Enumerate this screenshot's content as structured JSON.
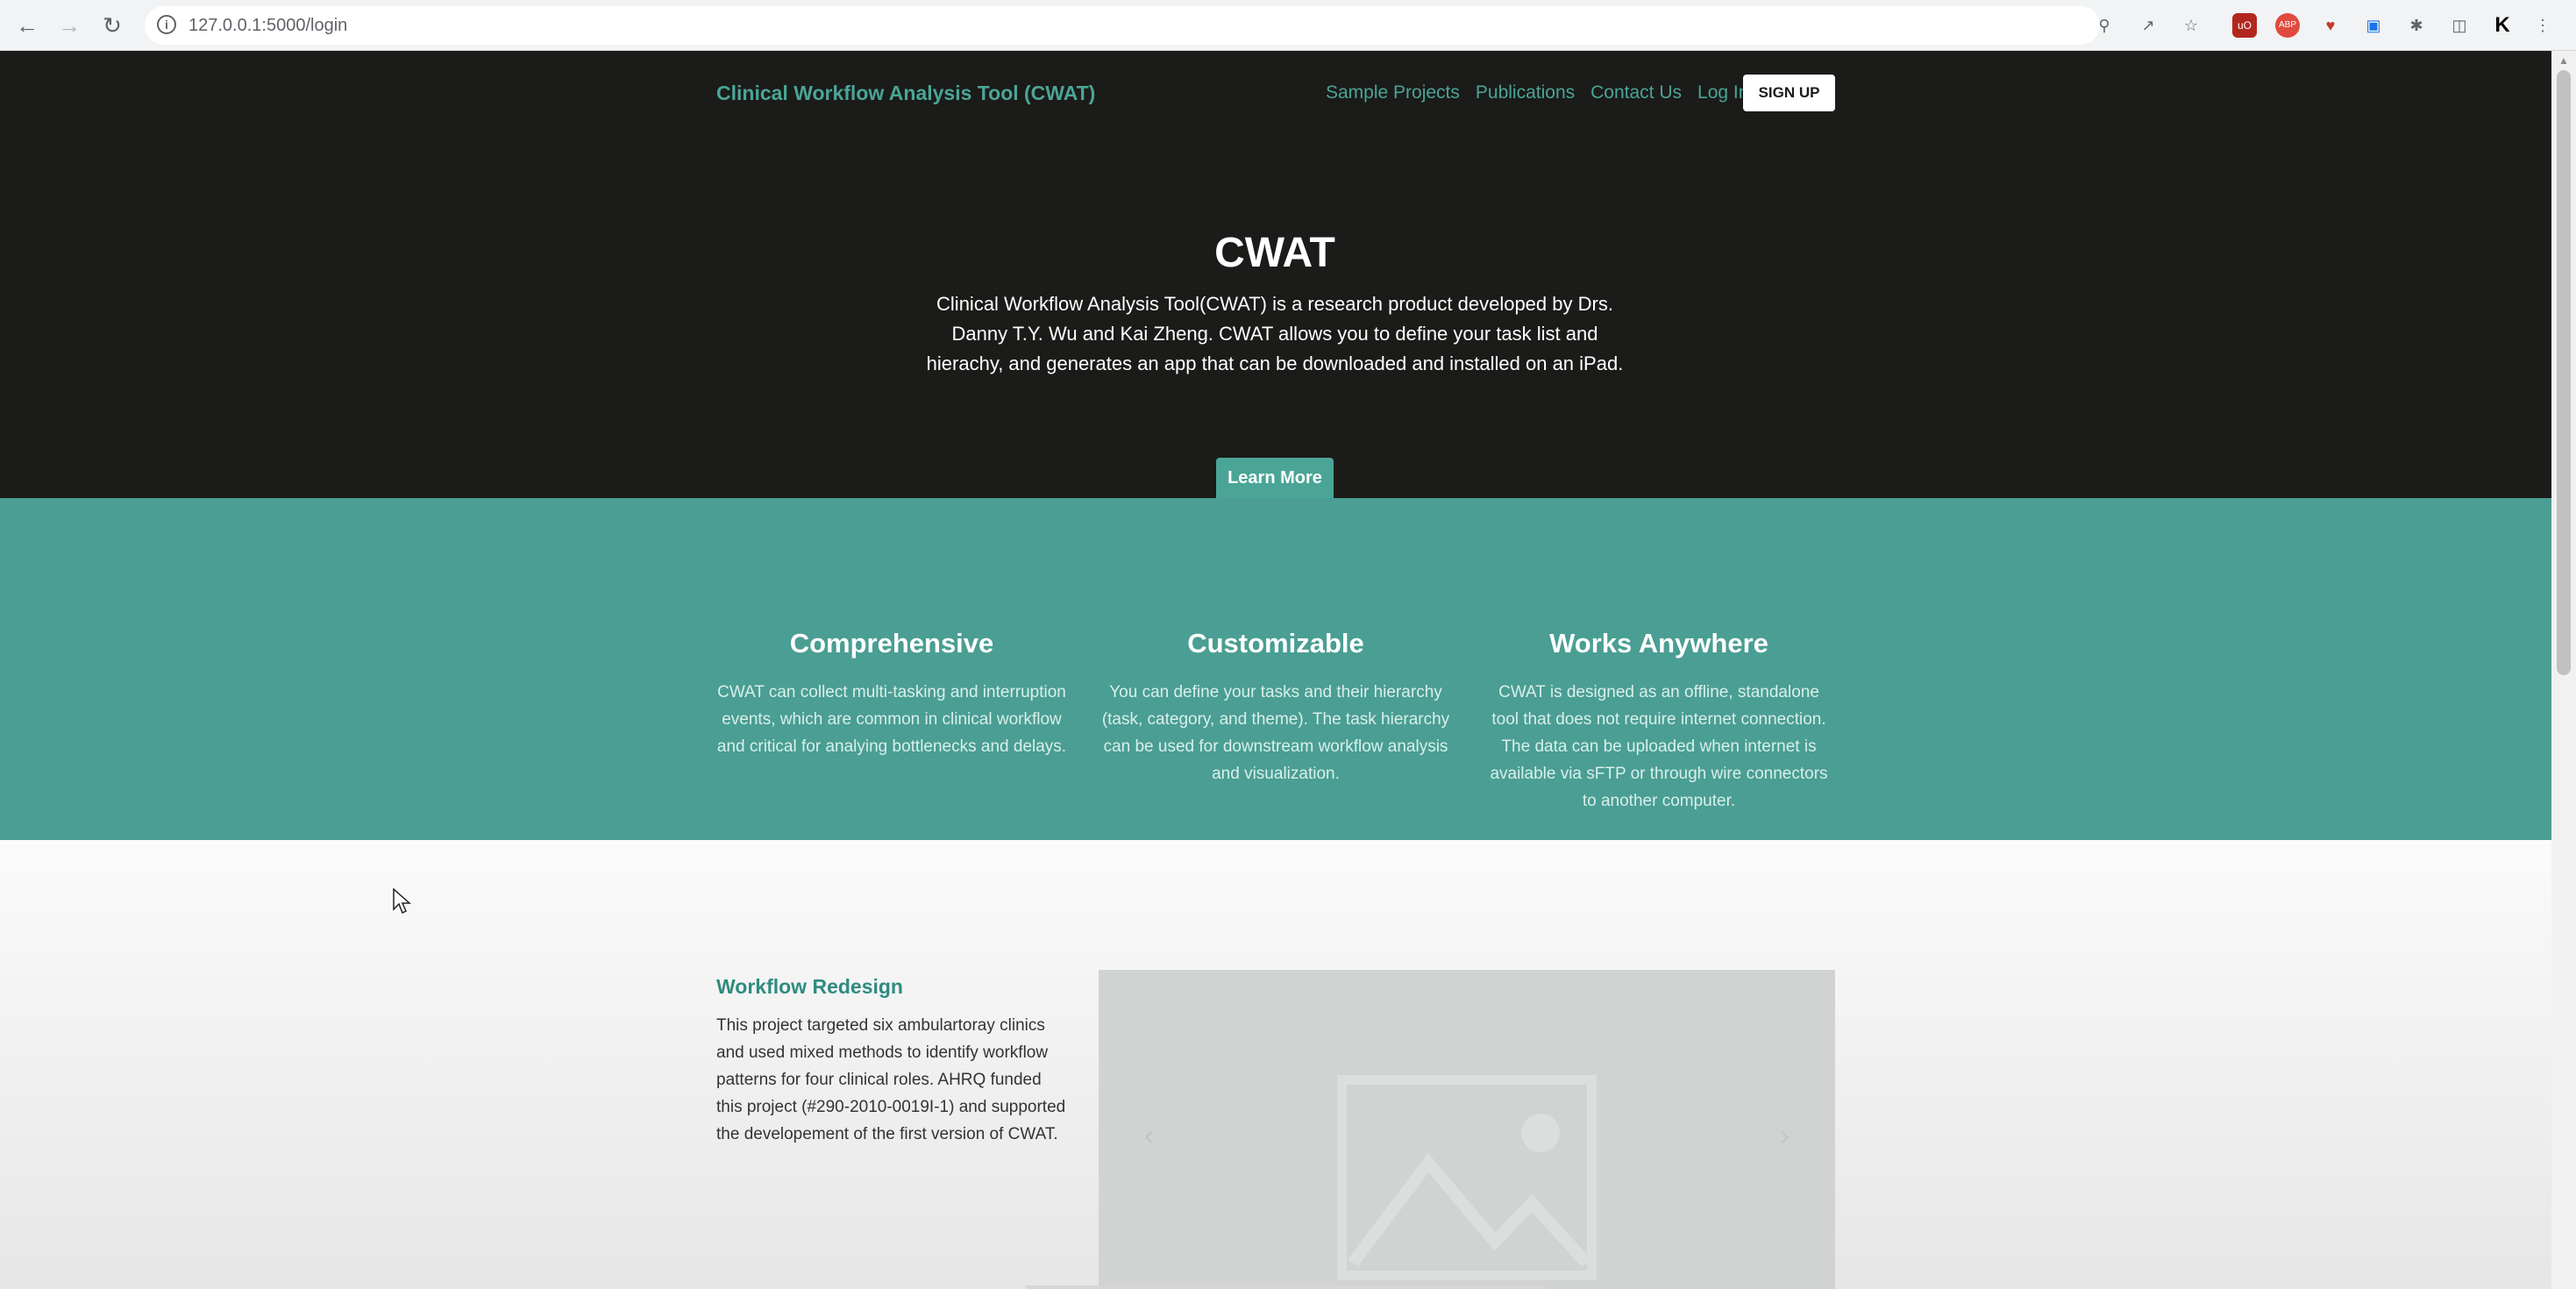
{
  "browser": {
    "url": "127.0.0.1:5000/login"
  },
  "navbar": {
    "brand": "Clinical Workflow Analysis Tool (CWAT)",
    "links": [
      "Sample Projects",
      "Publications",
      "Contact Us",
      "Log In"
    ],
    "signup_label": "SIGN UP"
  },
  "hero": {
    "title": "CWAT",
    "description": "Clinical Workflow Analysis Tool(CWAT) is a research product developed by Drs. Danny T.Y. Wu and Kai Zheng. CWAT allows you to define your task list and hierachy, and generates an app that can be downloaded and installed on an iPad.",
    "learn_more_label": "Learn More"
  },
  "features": [
    {
      "title": "Comprehensive",
      "text": "CWAT can collect multi-tasking and interruption events, which are common in clinical workflow and critical for analying bottlenecks and delays."
    },
    {
      "title": "Customizable",
      "text": "You can define your tasks and their hierarchy (task, category, and theme). The task hierarchy can be used for downstream workflow analysis and visualization."
    },
    {
      "title": "Works Anywhere",
      "text": "CWAT is designed as an offline, standalone tool that does not require internet connection. The data can be uploaded when internet is available via sFTP or through wire connectors to another computer."
    }
  ],
  "project": {
    "title": "Workflow Redesign",
    "description": "This project targeted six ambulartoray clinics and used mixed methods to identify workflow patterns for four clinical roles. AHRQ funded this project (#290-2010-0019I-1) and supported the developement of the first version of CWAT."
  },
  "colors": {
    "accent": "#4aa597",
    "hero_bg": "#1b1b19",
    "features_bg": "#4a9e93"
  }
}
